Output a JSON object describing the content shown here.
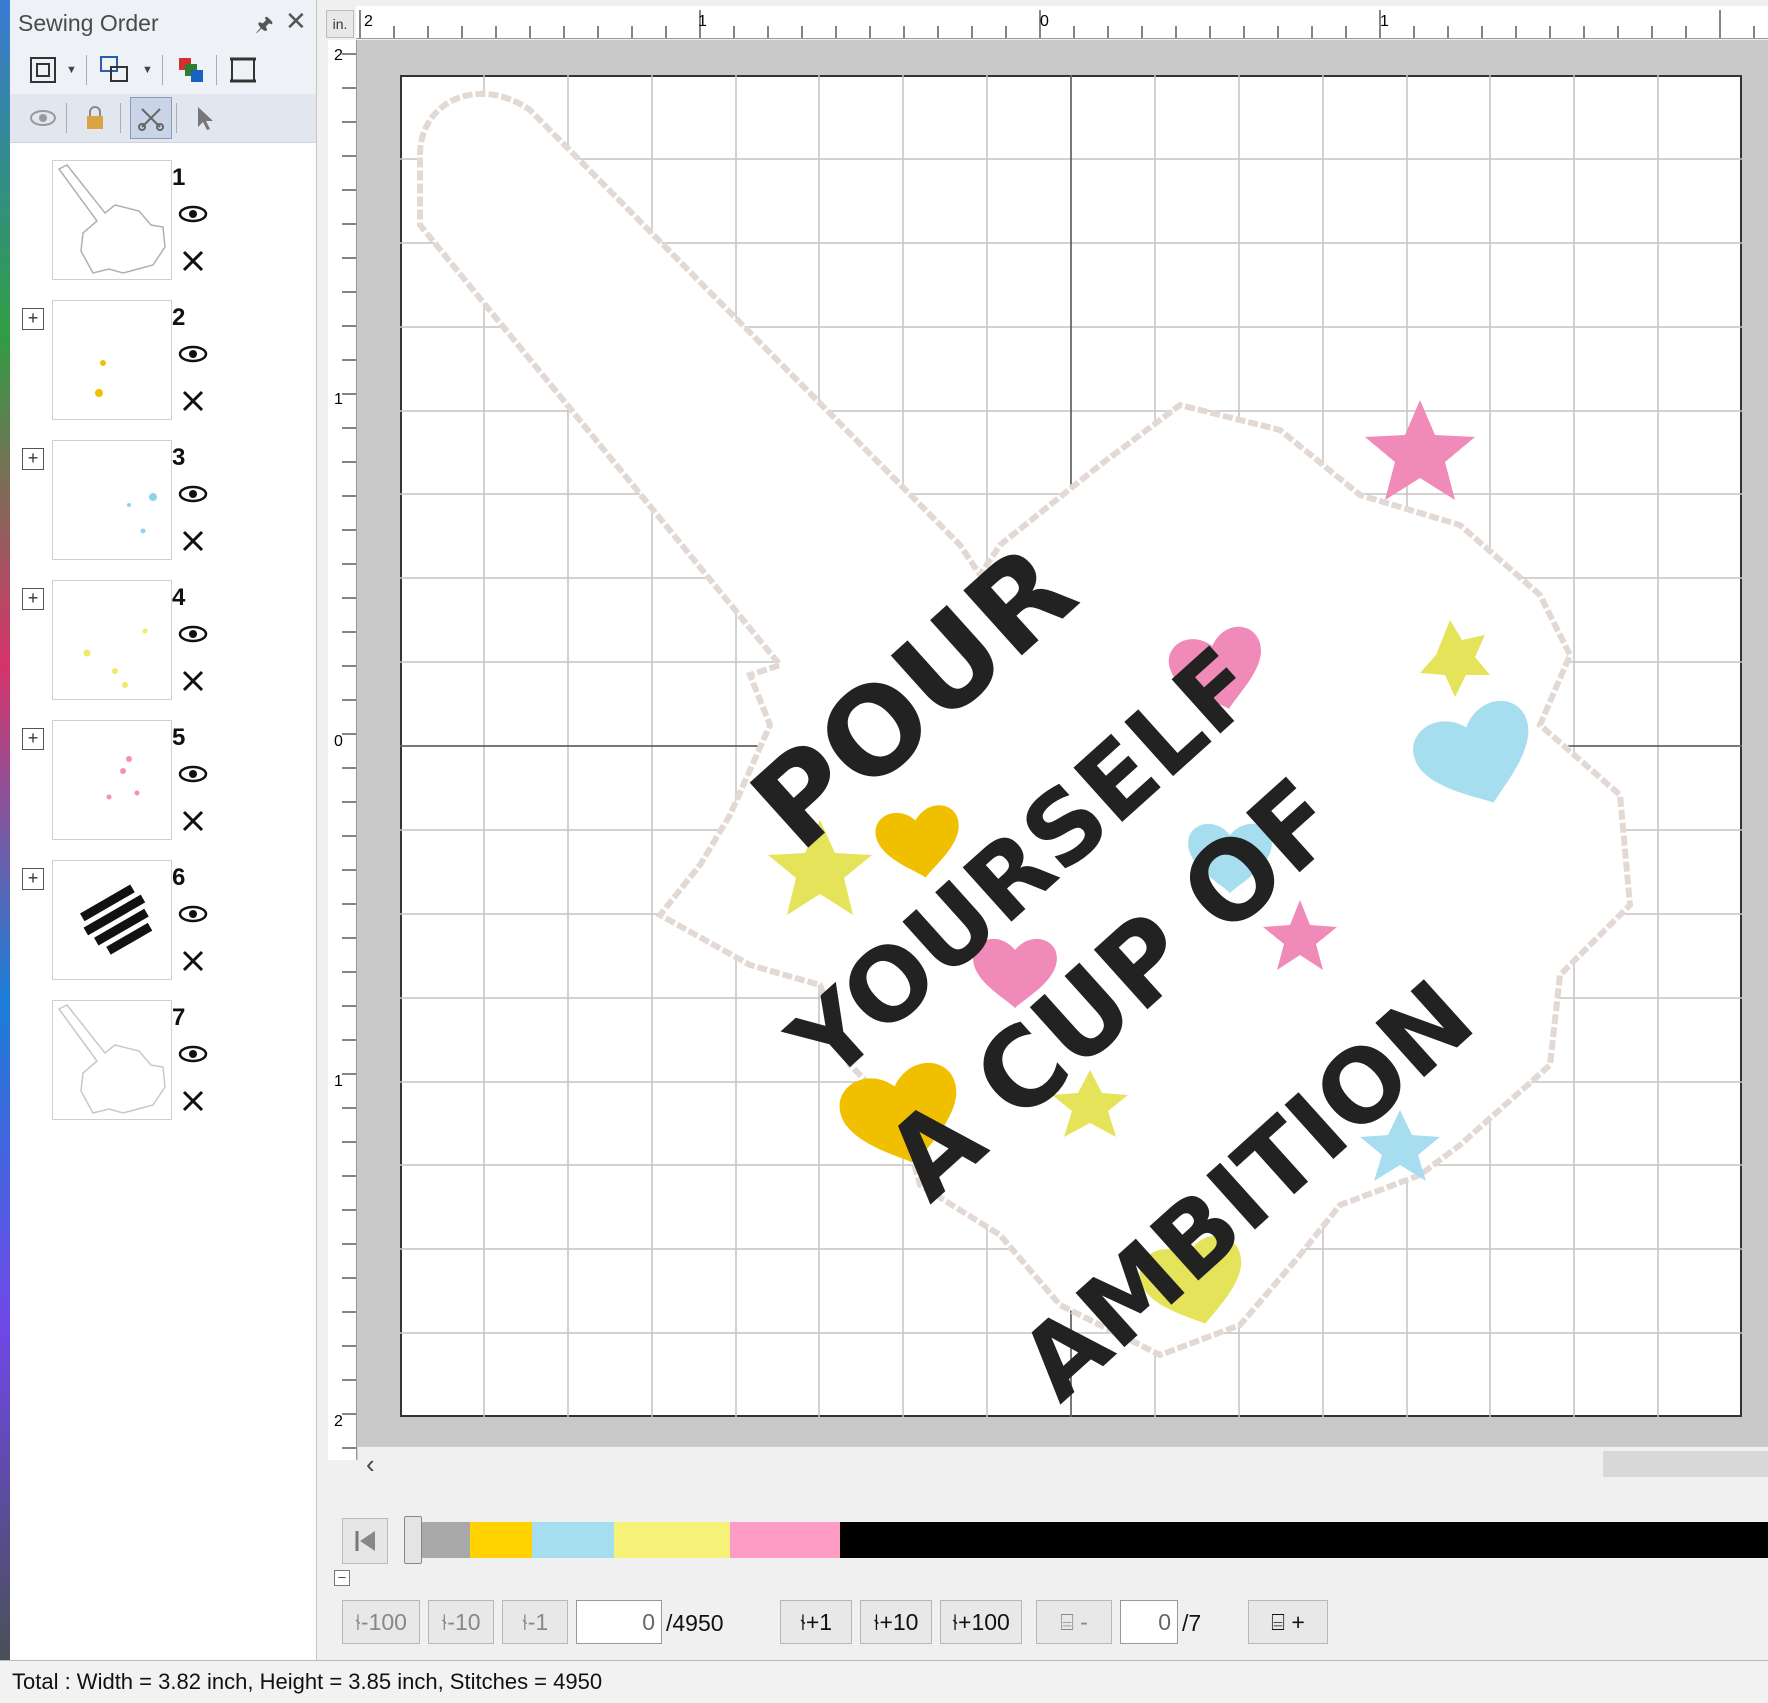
{
  "panel": {
    "title": "Sewing Order",
    "items": [
      {
        "number": "1"
      },
      {
        "number": "2"
      },
      {
        "number": "3"
      },
      {
        "number": "4"
      },
      {
        "number": "5"
      },
      {
        "number": "6"
      },
      {
        "number": "7"
      }
    ]
  },
  "ruler": {
    "unit": "in.",
    "h_labels": [
      "2",
      "1",
      "0",
      "1"
    ],
    "v_labels": [
      "2",
      "1",
      "0",
      "1",
      "2"
    ]
  },
  "design": {
    "lines": [
      "POUR",
      "YOURSELF",
      "A CUP OF",
      "AMBITION"
    ],
    "thread_colors": [
      "#a8a8a8",
      "#ffd200",
      "#a6def0",
      "#f7f27a",
      "#ff9cc6",
      "#000000"
    ]
  },
  "stitch_nav": {
    "minus100": "-100",
    "minus10": "-10",
    "minus1": "-1",
    "current": "0",
    "total": "/4950",
    "plus1": "+1",
    "plus10": "+10",
    "plus100": "+100",
    "minus_frame": "-",
    "frame_current": "0",
    "frame_total": "/7",
    "plus_frame": "+"
  },
  "status": "Total : Width = 3.82 inch, Height = 3.85 inch, Stitches = 4950"
}
